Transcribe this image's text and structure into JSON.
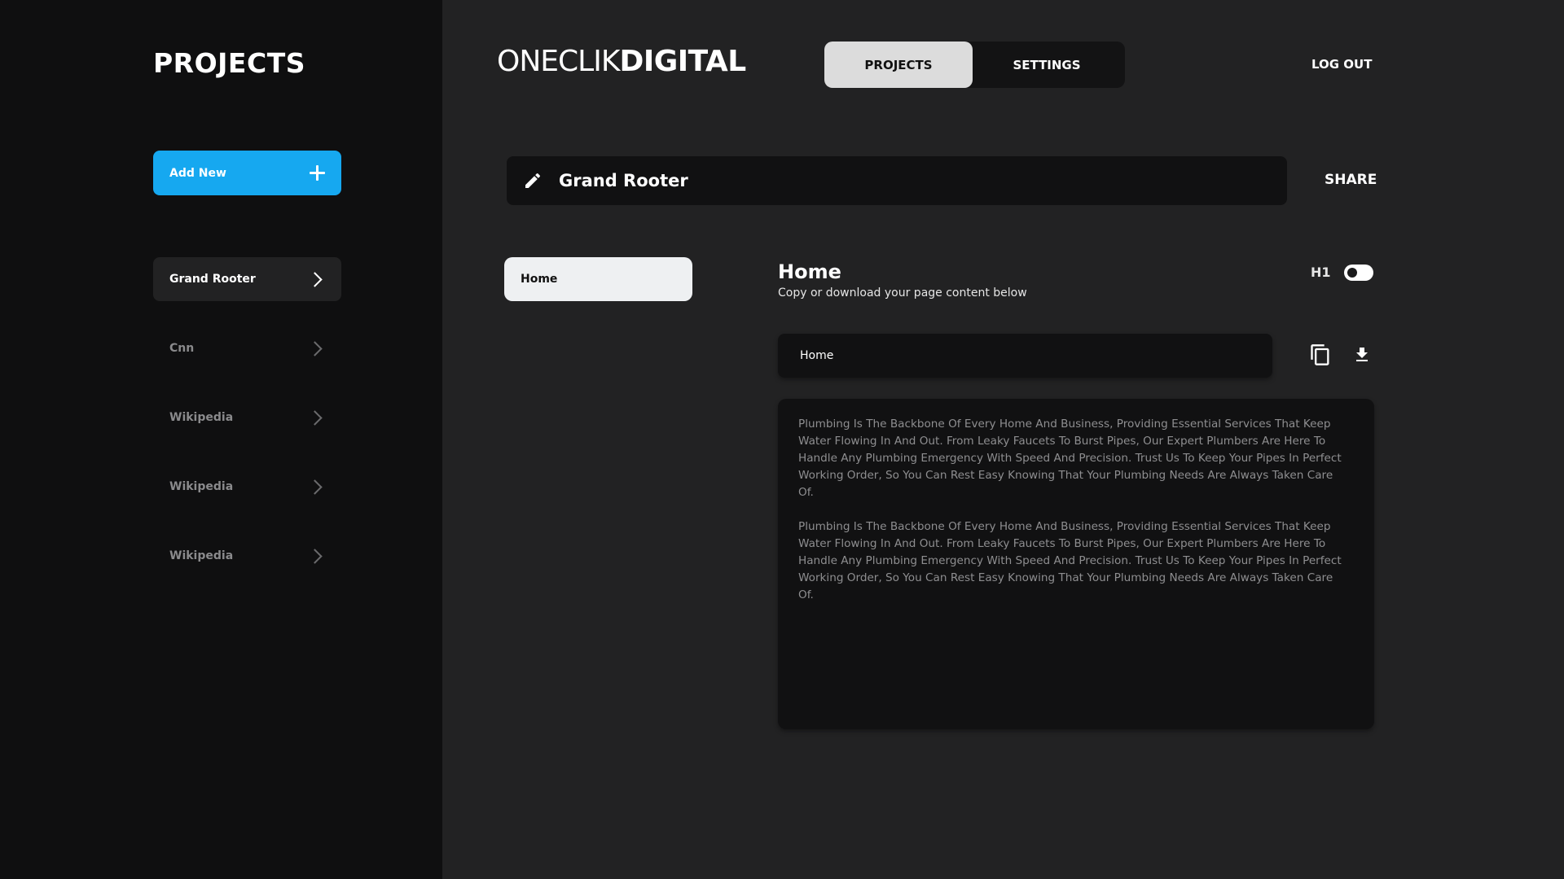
{
  "sidebar": {
    "title": "PROJECTS",
    "add_new_label": "Add New",
    "items": [
      {
        "label": "Grand Rooter"
      },
      {
        "label": "Cnn"
      },
      {
        "label": "Wikipedia"
      },
      {
        "label": "Wikipedia"
      },
      {
        "label": "Wikipedia"
      }
    ]
  },
  "header": {
    "logo_light": "ONECLIK",
    "logo_bold": "DIGITAL",
    "tabs": [
      {
        "label": "PROJECTS"
      },
      {
        "label": "SETTINGS"
      }
    ],
    "logout_label": "LOG OUT"
  },
  "project": {
    "name": "Grand Rooter",
    "share_label": "SHARE"
  },
  "pages": [
    {
      "label": "Home"
    }
  ],
  "content": {
    "heading": "Home",
    "subtitle": "Copy or download your page content below",
    "h1_label": "H1",
    "field_value": "Home",
    "paragraphs": [
      "Plumbing Is The Backbone Of Every Home And Business, Providing Essential Services That Keep Water Flowing In And Out. From Leaky Faucets To Burst Pipes, Our Expert Plumbers Are Here To Handle Any Plumbing Emergency With Speed And Precision. Trust Us To Keep Your Pipes In Perfect Working Order, So You Can Rest Easy Knowing That Your Plumbing Needs Are Always Taken Care Of.",
      "Plumbing Is The Backbone Of Every Home And Business, Providing Essential Services That Keep Water Flowing In And Out. From Leaky Faucets To Burst Pipes, Our Expert Plumbers Are Here To Handle Any Plumbing Emergency With Speed And Precision. Trust Us To Keep Your Pipes In Perfect Working Order, So You Can Rest Easy Knowing That Your Plumbing Needs Are Always Taken Care Of."
    ]
  },
  "icons": {
    "add": "plus-icon",
    "item_arrow": "chevron-right-icon",
    "edit": "pencil-icon",
    "copy": "copy-icon",
    "download": "download-icon"
  },
  "colors": {
    "accent": "#16a8f0",
    "sidebar_bg": "#0f0f10",
    "main_bg": "#222223",
    "panel_bg": "#111112"
  }
}
